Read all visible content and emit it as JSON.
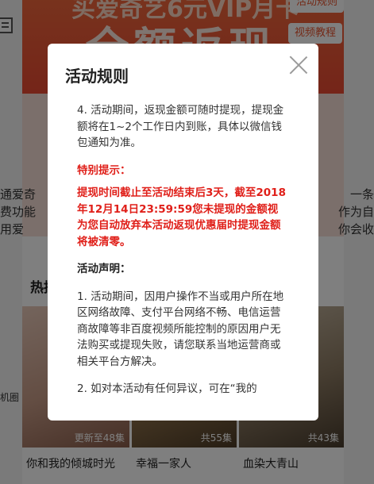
{
  "background": {
    "banner_top_text": "买爱奇艺6元VIP月卡",
    "banner_main_text": "全额返现",
    "banner_button_1": "活动规则",
    "banner_button_2": "视频教程",
    "left_side_text": "通爱奇\n费功能\n用爱",
    "right_side_text": "一条\n作为自\n你会收",
    "hot_title": "热播",
    "side_small_text": "机圈",
    "posters": [
      {
        "badge": "更新至48集",
        "caption": "你和我的倾城时光"
      },
      {
        "badge": "共55集",
        "caption": "幸福一家人"
      },
      {
        "badge": "共43集",
        "caption": "血染大青山"
      }
    ]
  },
  "modal": {
    "title": "活动规则",
    "item4": "4. 活动期间，返现金额可随时提现，提现金额将在1~2个工作日内到账，具体以微信钱包通知为准。",
    "notice_title": "特别提示：",
    "notice_text": "提现时间截止至活动结束后3天，截至2018年12月14日23:59:59您未提现的金额视为您自动放弃本活动返现优惠届时提现金额将被清零。",
    "statement_title": "活动声明：",
    "statement_1": "1. 活动期间，因用户操作不当或用户所在地区网络故障、支付平台网络不畅、电信运营商故障等非百度视频所能控制的原因用户无法购买或提现失败，请您联系当地运营商或相关平台方解决。",
    "statement_2": "2. 如对本活动有任何异议，可在“我的"
  },
  "colors": {
    "overlay": "rgba(0,0,0,0.5)",
    "notice_red": "#e0201a",
    "banner": "#ea4a32"
  },
  "icons": {
    "close": "close-icon",
    "menu": "menu-icon"
  }
}
